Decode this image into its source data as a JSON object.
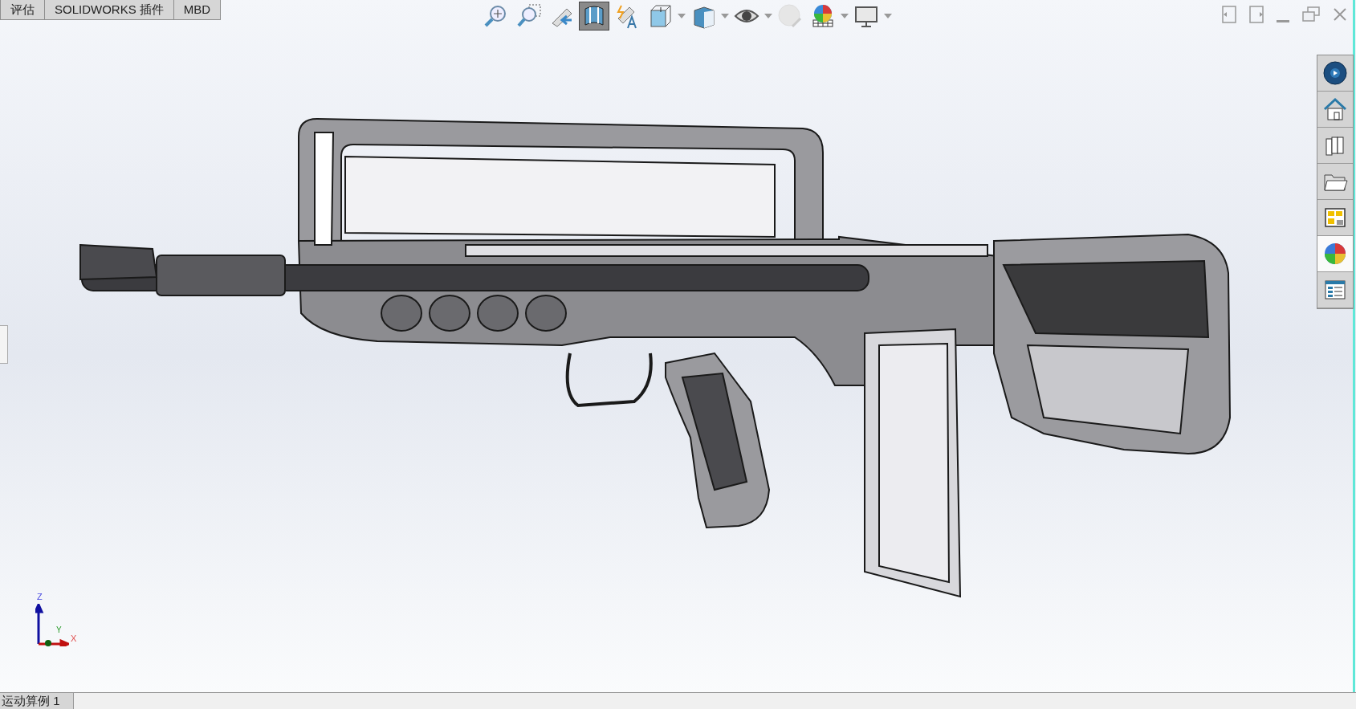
{
  "tabs": [
    {
      "label": "评估"
    },
    {
      "label": "SOLIDWORKS 插件"
    },
    {
      "label": "MBD"
    }
  ],
  "toolbar": [
    {
      "kind": "zoom-fit",
      "selected": false,
      "dropdown": false
    },
    {
      "kind": "zoom-area",
      "selected": false,
      "dropdown": false
    },
    {
      "kind": "previous-view",
      "selected": false,
      "dropdown": false
    },
    {
      "kind": "section-view",
      "selected": true,
      "dropdown": false
    },
    {
      "kind": "dynamic-annotation",
      "selected": false,
      "dropdown": false
    },
    {
      "kind": "view-orientation",
      "selected": false,
      "dropdown": true
    },
    {
      "kind": "display-style",
      "selected": false,
      "dropdown": true
    },
    {
      "kind": "hide-show",
      "selected": false,
      "dropdown": true
    },
    {
      "kind": "edit-appearance",
      "selected": false,
      "dropdown": false
    },
    {
      "kind": "scene",
      "selected": false,
      "dropdown": true
    },
    {
      "kind": "view-settings",
      "selected": false,
      "dropdown": true
    }
  ],
  "task_pane": [
    {
      "kind": "resources",
      "selected": false
    },
    {
      "kind": "home",
      "selected": false
    },
    {
      "kind": "library",
      "selected": false
    },
    {
      "kind": "explorer",
      "selected": false
    },
    {
      "kind": "palette",
      "selected": false
    },
    {
      "kind": "appearances",
      "selected": true
    },
    {
      "kind": "properties",
      "selected": false
    }
  ],
  "triad": {
    "z": "Z",
    "y": "Y",
    "x": "X"
  },
  "bottom_tabs": [
    {
      "label": "运动算例 1"
    }
  ]
}
